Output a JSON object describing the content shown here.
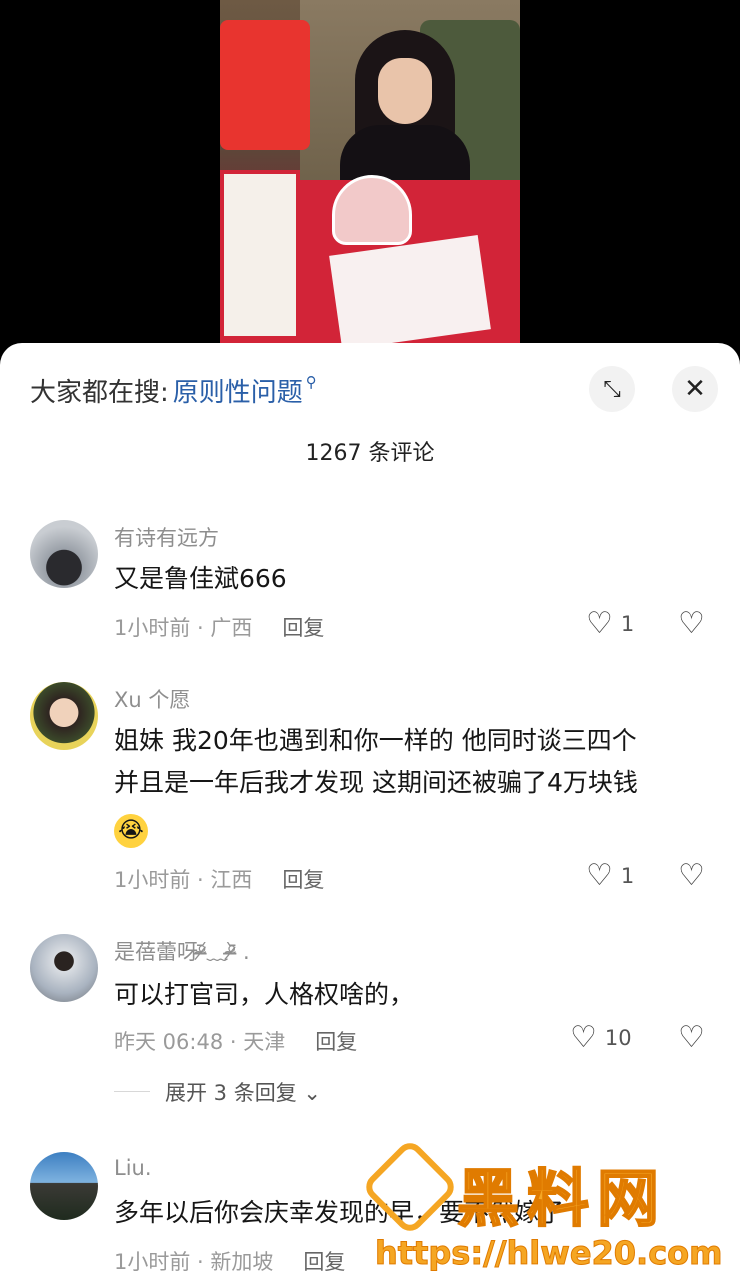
{
  "search": {
    "label": "大家都在搜:",
    "term": "原则性问题",
    "icon": "search-icon"
  },
  "buttons": {
    "expand_icon": "⤡",
    "close_icon": "✕"
  },
  "comment_count": "1267 条评论",
  "comments": [
    {
      "user": "有诗有远方",
      "text": "又是鲁佳斌666",
      "time_loc": "1小时前 · 广西",
      "reply": "回复",
      "likes": "1"
    },
    {
      "user": "Xu 个愿",
      "text_line1": "姐妹 我20年也遇到和你一样的 他同时谈三四个",
      "text_line2": "并且是一年后我才发现 这期间还被骗了4万块钱",
      "emoji": "😭",
      "time_loc": "1小时前 · 江西",
      "reply": "回复",
      "likes": "1"
    },
    {
      "user": "是蓓蕾呀ᵒ̴̶̷᷄﹏ᵒ̴̶̷᷅ .",
      "text": "可以打官司，人格权啥的，",
      "time_loc": "昨天 06:48 · 天津",
      "reply": "回复",
      "likes": "10",
      "expand": "展开 3 条回复 ⌄"
    },
    {
      "user": "Liu.",
      "text": "多年以后你会庆幸发现的早，要不然嫁了",
      "time_loc": "1小时前 · 新加坡",
      "reply": "回复"
    }
  ],
  "watermark": {
    "title": "黑料网",
    "url": "https://hlwe20.com"
  }
}
